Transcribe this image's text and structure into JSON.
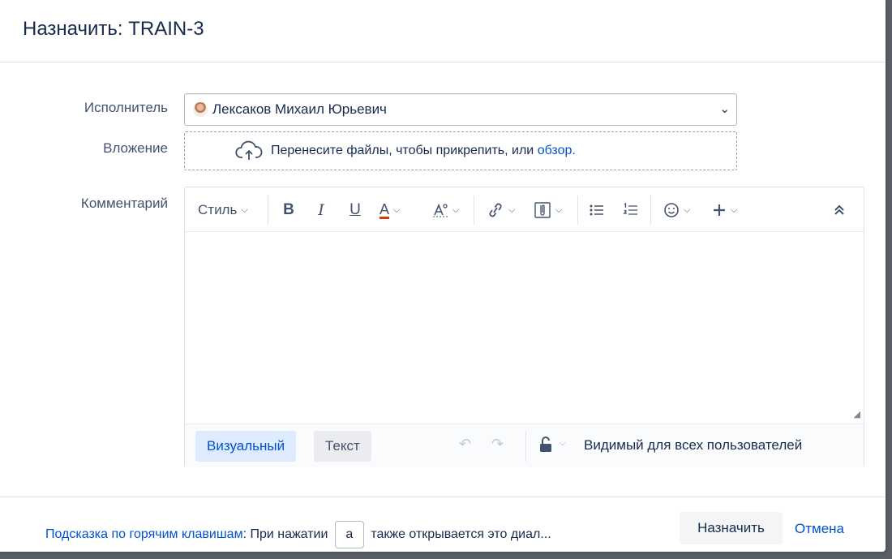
{
  "dialog": {
    "title": "Назначить: TRAIN-3"
  },
  "fields": {
    "assignee_label": "Исполнитель",
    "assignee_value": "Лексаков Михаил Юрьевич",
    "attachment_label": "Вложение",
    "attachment_text": "Перенесите файлы, чтобы прикрепить, или",
    "attachment_link": "обзор.",
    "comment_label": "Комментарий"
  },
  "toolbar": {
    "style_label": "Стиль",
    "bold": "B",
    "italic": "I",
    "underline": "U",
    "text_color": "A",
    "text_color_bar": "#de350b"
  },
  "editor": {
    "mode_visual": "Визуальный",
    "mode_text": "Текст",
    "visibility": "Видимый для всех пользователей"
  },
  "footer": {
    "hint_link": "Подсказка по горячим клавишам",
    "hint_pre": ": При нажатии",
    "hint_key": "a",
    "hint_post": "также открывается это диал...",
    "assign_button": "Назначить",
    "cancel_link": "Отмена"
  },
  "colors": {
    "link": "#0052cc",
    "accent_bg": "#deebff"
  }
}
